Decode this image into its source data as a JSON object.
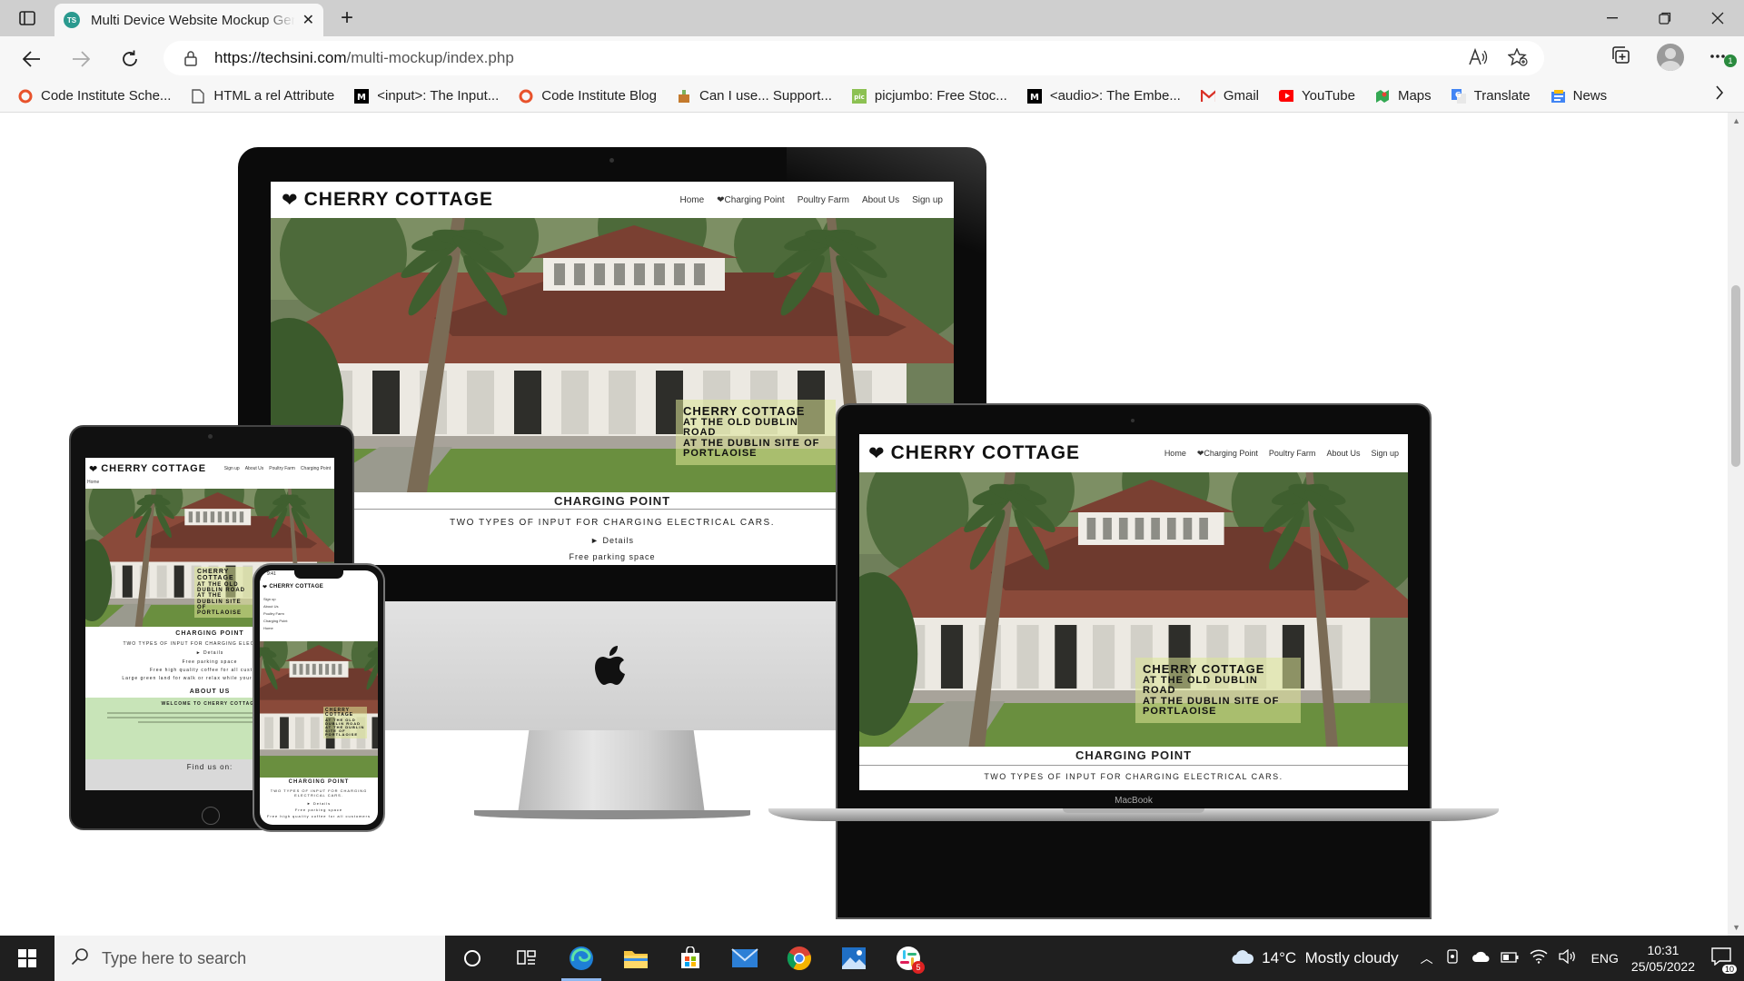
{
  "browser": {
    "tab_title": "Multi Device Website Mockup Generator",
    "favicon_text": "TS",
    "url_host": "https://techsini.com",
    "url_path": "/multi-mockup/index.php",
    "profile_badge": "1"
  },
  "bookmarks": [
    {
      "label": "Code Institute Sche...",
      "icon": "ring-icon",
      "color": "#e8522b"
    },
    {
      "label": "HTML a rel Attribute",
      "icon": "page-icon",
      "color": "#555555"
    },
    {
      "label": "<input>: The Input...",
      "icon": "mdn-icon",
      "color": "#000000"
    },
    {
      "label": "Code Institute Blog",
      "icon": "ring-icon",
      "color": "#e8522b"
    },
    {
      "label": "Can I use... Support...",
      "icon": "caniuse-icon",
      "color": "#c47a2d"
    },
    {
      "label": "picjumbo: Free Stoc...",
      "icon": "picjumbo-icon",
      "color": "#8cc152"
    },
    {
      "label": "<audio>: The Embe...",
      "icon": "mdn-icon",
      "color": "#000000"
    },
    {
      "label": "Gmail",
      "icon": "gmail-icon",
      "color": "#d93025"
    },
    {
      "label": "YouTube",
      "icon": "youtube-icon",
      "color": "#ff0000"
    },
    {
      "label": "Maps",
      "icon": "maps-icon",
      "color": "#34a853"
    },
    {
      "label": "Translate",
      "icon": "translate-icon",
      "color": "#4285f4"
    },
    {
      "label": "News",
      "icon": "news-icon",
      "color": "#4285f4"
    }
  ],
  "site": {
    "logo": "CHERRY COTTAGE",
    "nav": [
      "Home",
      "Charging Point",
      "Poultry Farm",
      "About Us",
      "Sign up"
    ],
    "caption_title": "CHERRY COTTAGE",
    "caption_lines": [
      "AT THE OLD DUBLIN ROAD",
      "AT THE DUBLIN SITE OF",
      "PORTLAOISE"
    ],
    "section_charging": "CHARGING POINT",
    "charging_desc": "TWO TYPES OF INPUT FOR CHARGING ELECTRICAL CARS.",
    "details": "► Details",
    "free_parking": "Free parking space",
    "free_coffee": "Free high quality coffee for all customers",
    "large_green": "Large green land for walk or relax while your car is charging",
    "about_title": "ABOUT US",
    "welcome": "WELCOME TO CHERRY COTTAGE",
    "find_us": "Find us on:",
    "phone_time": "9:41",
    "macbook_label": "MacBook"
  },
  "taskbar": {
    "search_placeholder": "Type here to search",
    "weather": "14°C  Mostly cloudy",
    "language": "ENG",
    "time": "10:31",
    "date": "25/05/2022",
    "notification_count": "10",
    "slack_badge": "5"
  },
  "colors": {
    "caption_bg": "#dce696",
    "about_green": "#c8e4b8",
    "edge_blue": "#1e7fd6"
  }
}
